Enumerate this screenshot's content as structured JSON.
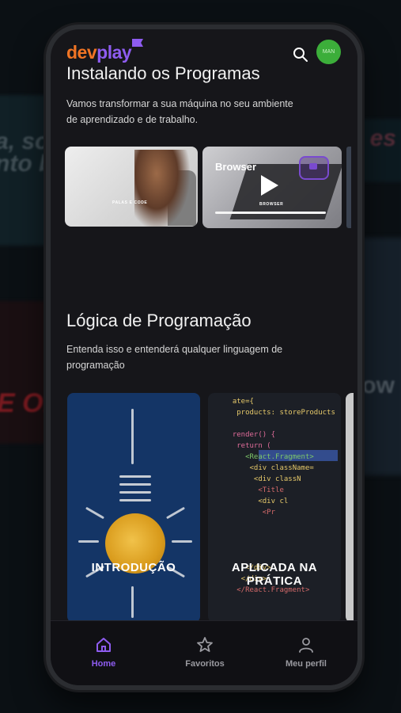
{
  "brand": {
    "logo_dev": "dev",
    "logo_play": "play"
  },
  "header": {
    "avatar_text": "MAN"
  },
  "sections": [
    {
      "title": "Instalando os Programas",
      "subtitle": "Vamos transformar a sua máquina no seu ambiente de aprendizado e de trabalho.",
      "cards": [
        {
          "caption": "PALAS E CODE"
        },
        {
          "title": "Browser",
          "caption": "BROWSER",
          "progress": 1.0
        }
      ]
    },
    {
      "title": "Lógica de Programação",
      "subtitle": "Entenda isso e entenderá qualquer linguagem de programação",
      "cards": [
        {
          "label": "INTRODUÇÃO"
        },
        {
          "label_line1": "APLICADA NA",
          "label_line2": "PRÁTICA"
        }
      ]
    }
  ],
  "code_lines": [
    "  ate={",
    "   products: storeProducts",
    "",
    "  render() {",
    "   return (",
    "     <React.Fragment>",
    "      <div className=",
    "       <div classN",
    "        <Title",
    "        <div cl",
    "         <Pr",
    "",
    "",
    "",
    "",
    "     </div>",
    "    </div>",
    "   </React.Fragment>"
  ],
  "background_text": {
    "left_top_1": "a, so",
    "left_top_2": "nto be",
    "left_red": "E OF L",
    "right_top": "es",
    "right_mid": "ow"
  },
  "nav": {
    "home": "Home",
    "favorites": "Favoritos",
    "profile": "Meu perfil"
  },
  "colors": {
    "accent": "#8e5cf0",
    "brand_orange": "#f07424",
    "avatar_green": "#3cae3a"
  }
}
